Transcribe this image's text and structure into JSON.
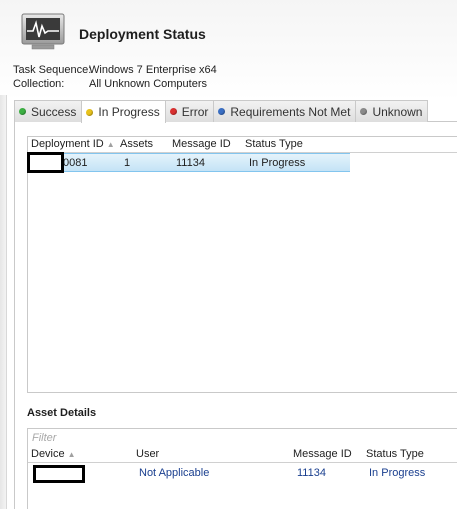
{
  "header": {
    "title": "Deployment Status",
    "icon": "monitor-heartbeat-icon"
  },
  "properties": {
    "task_sequence_label": "Task Sequence:",
    "task_sequence_value": "Windows 7 Enterprise x64",
    "collection_label": "Collection:",
    "collection_value": "All Unknown Computers"
  },
  "tabs": [
    {
      "label": "Success",
      "color": "#3cb043",
      "active": false
    },
    {
      "label": "In Progress",
      "color": "#e8c21c",
      "active": true
    },
    {
      "label": "Error",
      "color": "#d93030",
      "active": false
    },
    {
      "label": "Requirements Not Met",
      "color": "#3a6fc4",
      "active": false
    },
    {
      "label": "Unknown",
      "color": "#8a8a8a",
      "active": false
    }
  ],
  "deployments": {
    "columns": [
      "Deployment ID",
      "Assets",
      "Message ID",
      "Status Type"
    ],
    "sorted_column": "Deployment ID",
    "rows": [
      {
        "deployment_id": "0081",
        "assets": "1",
        "message_id": "11134",
        "status_type": "In Progress"
      }
    ]
  },
  "asset_details": {
    "title": "Asset Details",
    "filter_placeholder": "Filter",
    "columns": [
      "Device",
      "User",
      "Message ID",
      "Status Type"
    ],
    "sorted_column": "Device",
    "rows": [
      {
        "device": "",
        "user": "Not Applicable",
        "message_id": "11134",
        "status_type": "In Progress"
      }
    ]
  },
  "colors": {
    "selection": "#c4e3f6",
    "selection_border": "#83c5ee",
    "link_text": "#1a3f8f"
  }
}
